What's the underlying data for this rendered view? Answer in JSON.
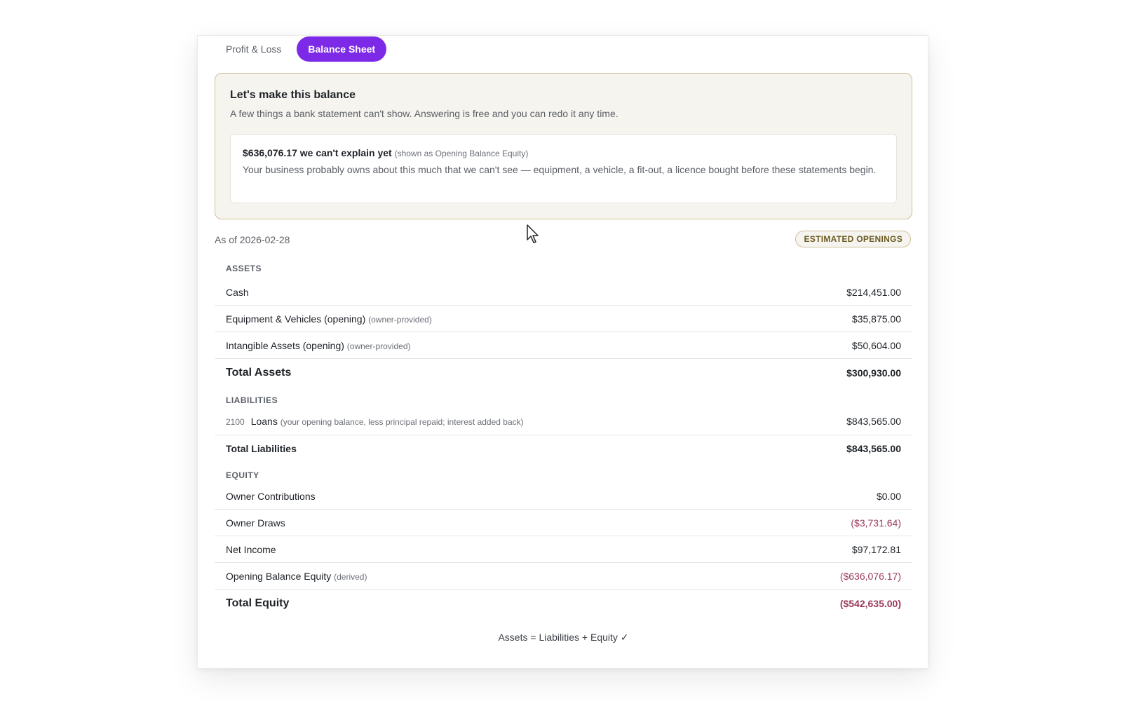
{
  "tabs": [
    {
      "label": "Profit & Loss",
      "active": false
    },
    {
      "label": "Balance Sheet",
      "active": true
    }
  ],
  "notice": {
    "title": "Let's make this balance",
    "subtitle": "A few things a bank statement can't show. Answering is free and you can redo it any time.",
    "unexplained_amount": "$636,076.17",
    "unexplained_headline": "we can't explain yet",
    "unexplained_note": "(shown as Opening Balance Equity)",
    "unexplained_description": "Your business probably owns about this much that we can't see — equipment, a vehicle, a fit-out, a licence bought before these statements begin."
  },
  "as_of": "As of 2026-02-28",
  "badge": "ESTIMATED OPENINGS",
  "assets": {
    "label": "ASSETS",
    "rows": [
      {
        "label": "Cash",
        "sub": "",
        "amount": "$214,451.00"
      },
      {
        "label": "Equipment & Vehicles (opening)",
        "sub": "(owner-provided)",
        "amount": "$35,875.00"
      },
      {
        "label": "Intangible Assets (opening)",
        "sub": "(owner-provided)",
        "amount": "$50,604.00"
      }
    ],
    "total_label": "Total Assets",
    "total_amount": "$300,930.00"
  },
  "liabilities": {
    "label": "LIABILITIES",
    "rows": [
      {
        "code": "2100",
        "label": "Loans",
        "sub": "(your opening balance, less principal repaid; interest added back)",
        "amount": "$843,565.00"
      }
    ],
    "total_label": "Total Liabilities",
    "total_amount": "$843,565.00"
  },
  "equity": {
    "label": "EQUITY",
    "rows": [
      {
        "label": "Owner Contributions",
        "sub": "",
        "amount": "$0.00"
      },
      {
        "label": "Owner Draws",
        "sub": "",
        "amount": "($3,731.64)"
      },
      {
        "label": "Net Income",
        "sub": "",
        "amount": "$97,172.81"
      },
      {
        "label": "Opening Balance Equity",
        "sub": "(derived)",
        "amount": "($636,076.17)"
      }
    ],
    "total_label": "Total Equity",
    "total_amount": "($542,635.00)"
  },
  "check_text": "Assets = Liabilities + Equity ✓",
  "colors": {
    "accent": "#7c2ae8",
    "notice_border": "#cdbf96",
    "negative": "#9a3a5a"
  }
}
